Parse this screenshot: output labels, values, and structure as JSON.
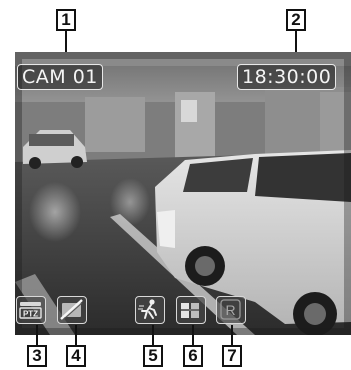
{
  "osd": {
    "camera_name": "CAM 01",
    "time": "18:30:00"
  },
  "callouts": {
    "c1": "1",
    "c2": "2",
    "c3": "3",
    "c4": "4",
    "c5": "5",
    "c6": "6",
    "c7": "7"
  },
  "status_icons": {
    "ptz_label": "PTZ",
    "record_label": "R",
    "icon_names": [
      "ptz-icon",
      "video-loss-icon",
      "motion-detection-icon",
      "sensor-icon",
      "record-icon"
    ]
  }
}
